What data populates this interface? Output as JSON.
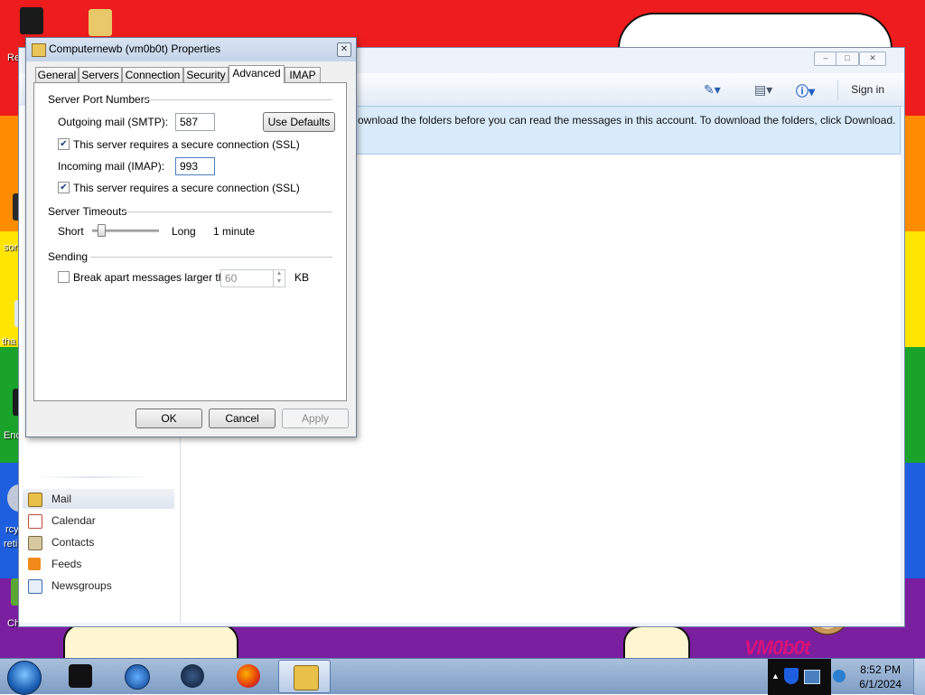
{
  "desktop": {
    "icon_labels": [
      "Re",
      "sor",
      "tha",
      "Enc",
      "rcy",
      "reti",
      "Ch"
    ],
    "brand_text": "VM0b0t"
  },
  "mail_window": {
    "toolbar": {
      "signin_label": "Sign in"
    },
    "info_message": "ownload the folders before you can read the messages in this account. To download the folders, click Download.",
    "nav": [
      {
        "label": "Mail",
        "icon": "mail-icon",
        "selected": true
      },
      {
        "label": "Calendar",
        "icon": "calendar-icon",
        "selected": false
      },
      {
        "label": "Contacts",
        "icon": "contacts-icon",
        "selected": false
      },
      {
        "label": "Feeds",
        "icon": "feeds-icon",
        "selected": false
      },
      {
        "label": "Newsgroups",
        "icon": "newsgroups-icon",
        "selected": false
      }
    ]
  },
  "dialog": {
    "title": "Computernewb (vm0b0t) Properties",
    "tabs": [
      {
        "label": "General",
        "active": false
      },
      {
        "label": "Servers",
        "active": false
      },
      {
        "label": "Connection",
        "active": false
      },
      {
        "label": "Security",
        "active": false
      },
      {
        "label": "Advanced",
        "active": true
      },
      {
        "label": "IMAP",
        "active": false
      }
    ],
    "server_ports": {
      "heading": "Server Port Numbers",
      "smtp_label": "Outgoing mail (SMTP):",
      "smtp_value": "587",
      "use_defaults_label": "Use Defaults",
      "smtp_ssl_label": "This server requires a secure connection (SSL)",
      "smtp_ssl_checked": true,
      "imap_label": "Incoming mail (IMAP):",
      "imap_value": "993",
      "imap_ssl_label": "This server requires a secure connection (SSL)",
      "imap_ssl_checked": true
    },
    "timeouts": {
      "heading": "Server Timeouts",
      "short_label": "Short",
      "long_label": "Long",
      "value_label": "1 minute",
      "slider_fraction": 0.1
    },
    "sending": {
      "heading": "Sending",
      "break_apart_label": "Break apart messages larger than",
      "break_apart_checked": false,
      "size_value": "60",
      "unit_label": "KB"
    },
    "buttons": {
      "ok": "OK",
      "cancel": "Cancel",
      "apply": "Apply"
    }
  },
  "taskbar": {
    "clock_time": "8:52 PM",
    "clock_date": "6/1/2024"
  },
  "colors": {
    "info_bar_bg": "#d9ebfa",
    "dialog_bg": "#f0f0f0",
    "taskbar": "#8fabd0"
  }
}
